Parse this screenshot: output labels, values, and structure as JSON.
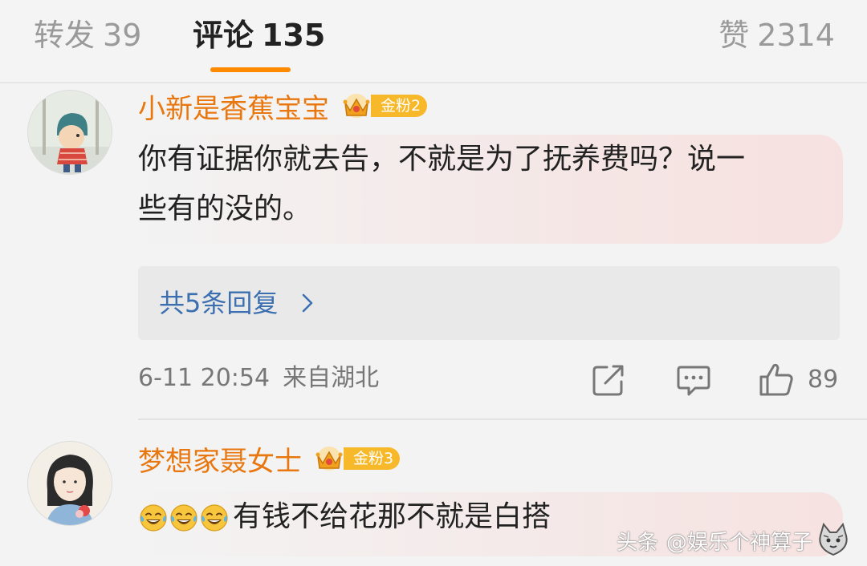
{
  "tabs": {
    "repost": {
      "label": "转发",
      "count": "39"
    },
    "comments": {
      "label": "评论",
      "count": "135"
    },
    "likes": {
      "label": "赞",
      "count": "2314"
    }
  },
  "comments": [
    {
      "username": "小新是香蕉宝宝",
      "fan_badge": "金粉2",
      "text_line1": "你有证据你就去告，不就是为了抚养费吗？说一",
      "text_line2": "些有的没的。",
      "replies_label": "共5条回复",
      "timestamp": "6-11 20:54",
      "location": "来自湖北",
      "likes": "89"
    },
    {
      "username": "梦想家聂女士",
      "fan_badge": "金粉3",
      "emoji_count": 3,
      "text": "有钱不给花那不就是白搭"
    }
  ],
  "watermark": {
    "platform": "头条",
    "account": "@娱乐个神算子"
  },
  "colors": {
    "username": "#e8770f",
    "active_tab_underline": "#ff8a00",
    "reply_link": "#3b6fb0",
    "badge": "#f7b92a"
  },
  "icons": [
    "share-icon",
    "comment-icon",
    "like-icon",
    "chevron-right-icon",
    "crown-icon",
    "laughing-tears-emoji"
  ]
}
